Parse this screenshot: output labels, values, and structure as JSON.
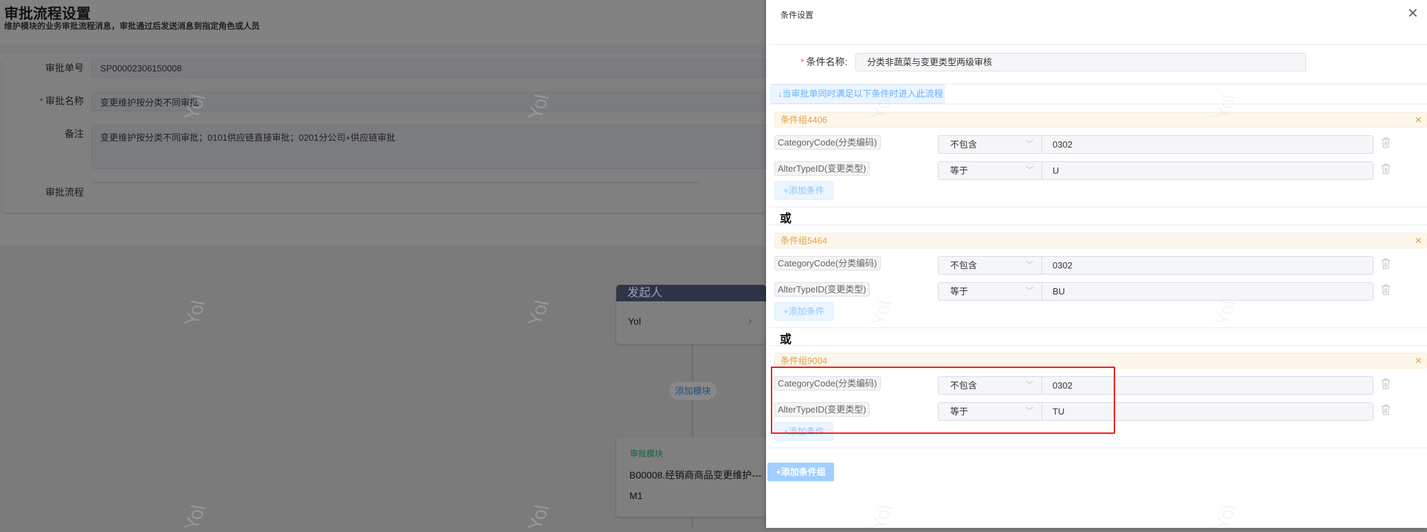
{
  "page": {
    "title": "审批流程设置",
    "subtitle": "维护模块的业务审批流程消息，审批通过后发送消息到指定角色或人员"
  },
  "form": {
    "number_label": "审批单号",
    "number_value": "SP00002306150008",
    "name_label": "审批名称",
    "name_value": "变更维护按分类不同审批",
    "remark_label": "备注",
    "remark_value": "变更维护按分类不同审批；0101供应链直接审批；0201分公司+供应链审批",
    "flow_label": "审批流程",
    "required_mark": "*"
  },
  "flow": {
    "initiator_title": "发起人",
    "initiator_value": "Yol",
    "add_module": "添加模块",
    "module_title": "审批模块",
    "module_name": "B00008.经销商商品变更维护---M1"
  },
  "watermark": "Yol",
  "panel": {
    "title": "条件设置",
    "name_label": "条件名称:",
    "name_value": "分类非蔬菜与变更类型两级审核",
    "tip": "↓当审批单同时满足以下条件时进入此流程",
    "or_label": "或",
    "add_condition": "+添加条件",
    "add_group": "+添加条件组",
    "close_glyph": "✕",
    "groups": [
      {
        "name": "条件组4406",
        "conditions": [
          {
            "field": "CategoryCode(分类编码)",
            "op": "不包含",
            "value": "0302"
          },
          {
            "field": "AlterTypeID(变更类型)",
            "op": "等于",
            "value": "U"
          }
        ]
      },
      {
        "name": "条件组5464",
        "conditions": [
          {
            "field": "CategoryCode(分类编码)",
            "op": "不包含",
            "value": "0302"
          },
          {
            "field": "AlterTypeID(变更类型)",
            "op": "等于",
            "value": "BU"
          }
        ]
      },
      {
        "name": "条件组9004",
        "conditions": [
          {
            "field": "CategoryCode(分类编码)",
            "op": "不包含",
            "value": "0302"
          },
          {
            "field": "AlterTypeID(变更类型)",
            "op": "等于",
            "value": "TU"
          }
        ]
      }
    ]
  },
  "colors": {
    "accent": "#409eff",
    "warning": "#e6a23c",
    "highlight": "#ff0000"
  }
}
